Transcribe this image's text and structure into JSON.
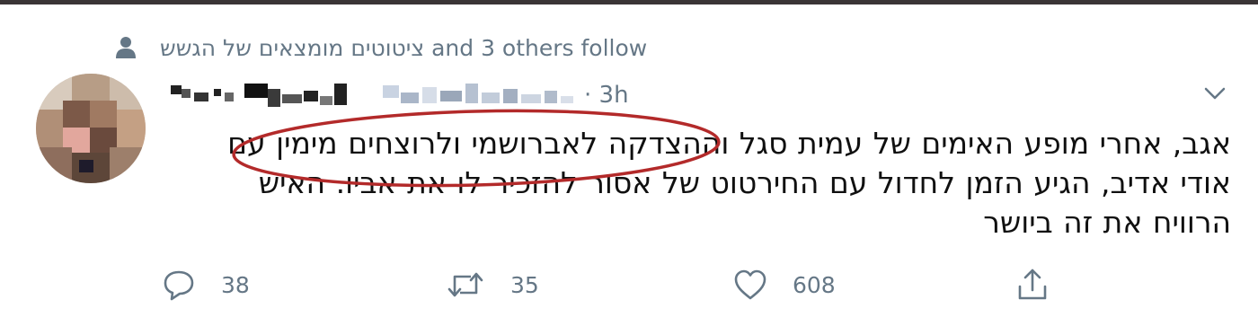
{
  "social_context": {
    "text": "ציטוטים מומצאים של הגשש and 3 others follow"
  },
  "tweet": {
    "timestamp": "· 3h",
    "text_lines": [
      "אגב, אחרי מופע האימים של עמית סגל וההצדקה לאברושמי ולרוצחים מימין עם",
      "אודי אדיב, הגיע הזמן לחדול עם החירטוט של אסור להזכיר לו את אביו. האיש",
      "הרוויח את זה ביושר"
    ],
    "highlight_color": "#b32a2a"
  },
  "actions": {
    "reply_count": "38",
    "retweet_count": "35",
    "like_count": "608"
  },
  "colors": {
    "secondary_text": "#657786",
    "top_rule": "#3a3536"
  },
  "icons": [
    "person-icon",
    "chevron-down-icon",
    "reply-icon",
    "retweet-icon",
    "like-icon",
    "share-icon"
  ]
}
